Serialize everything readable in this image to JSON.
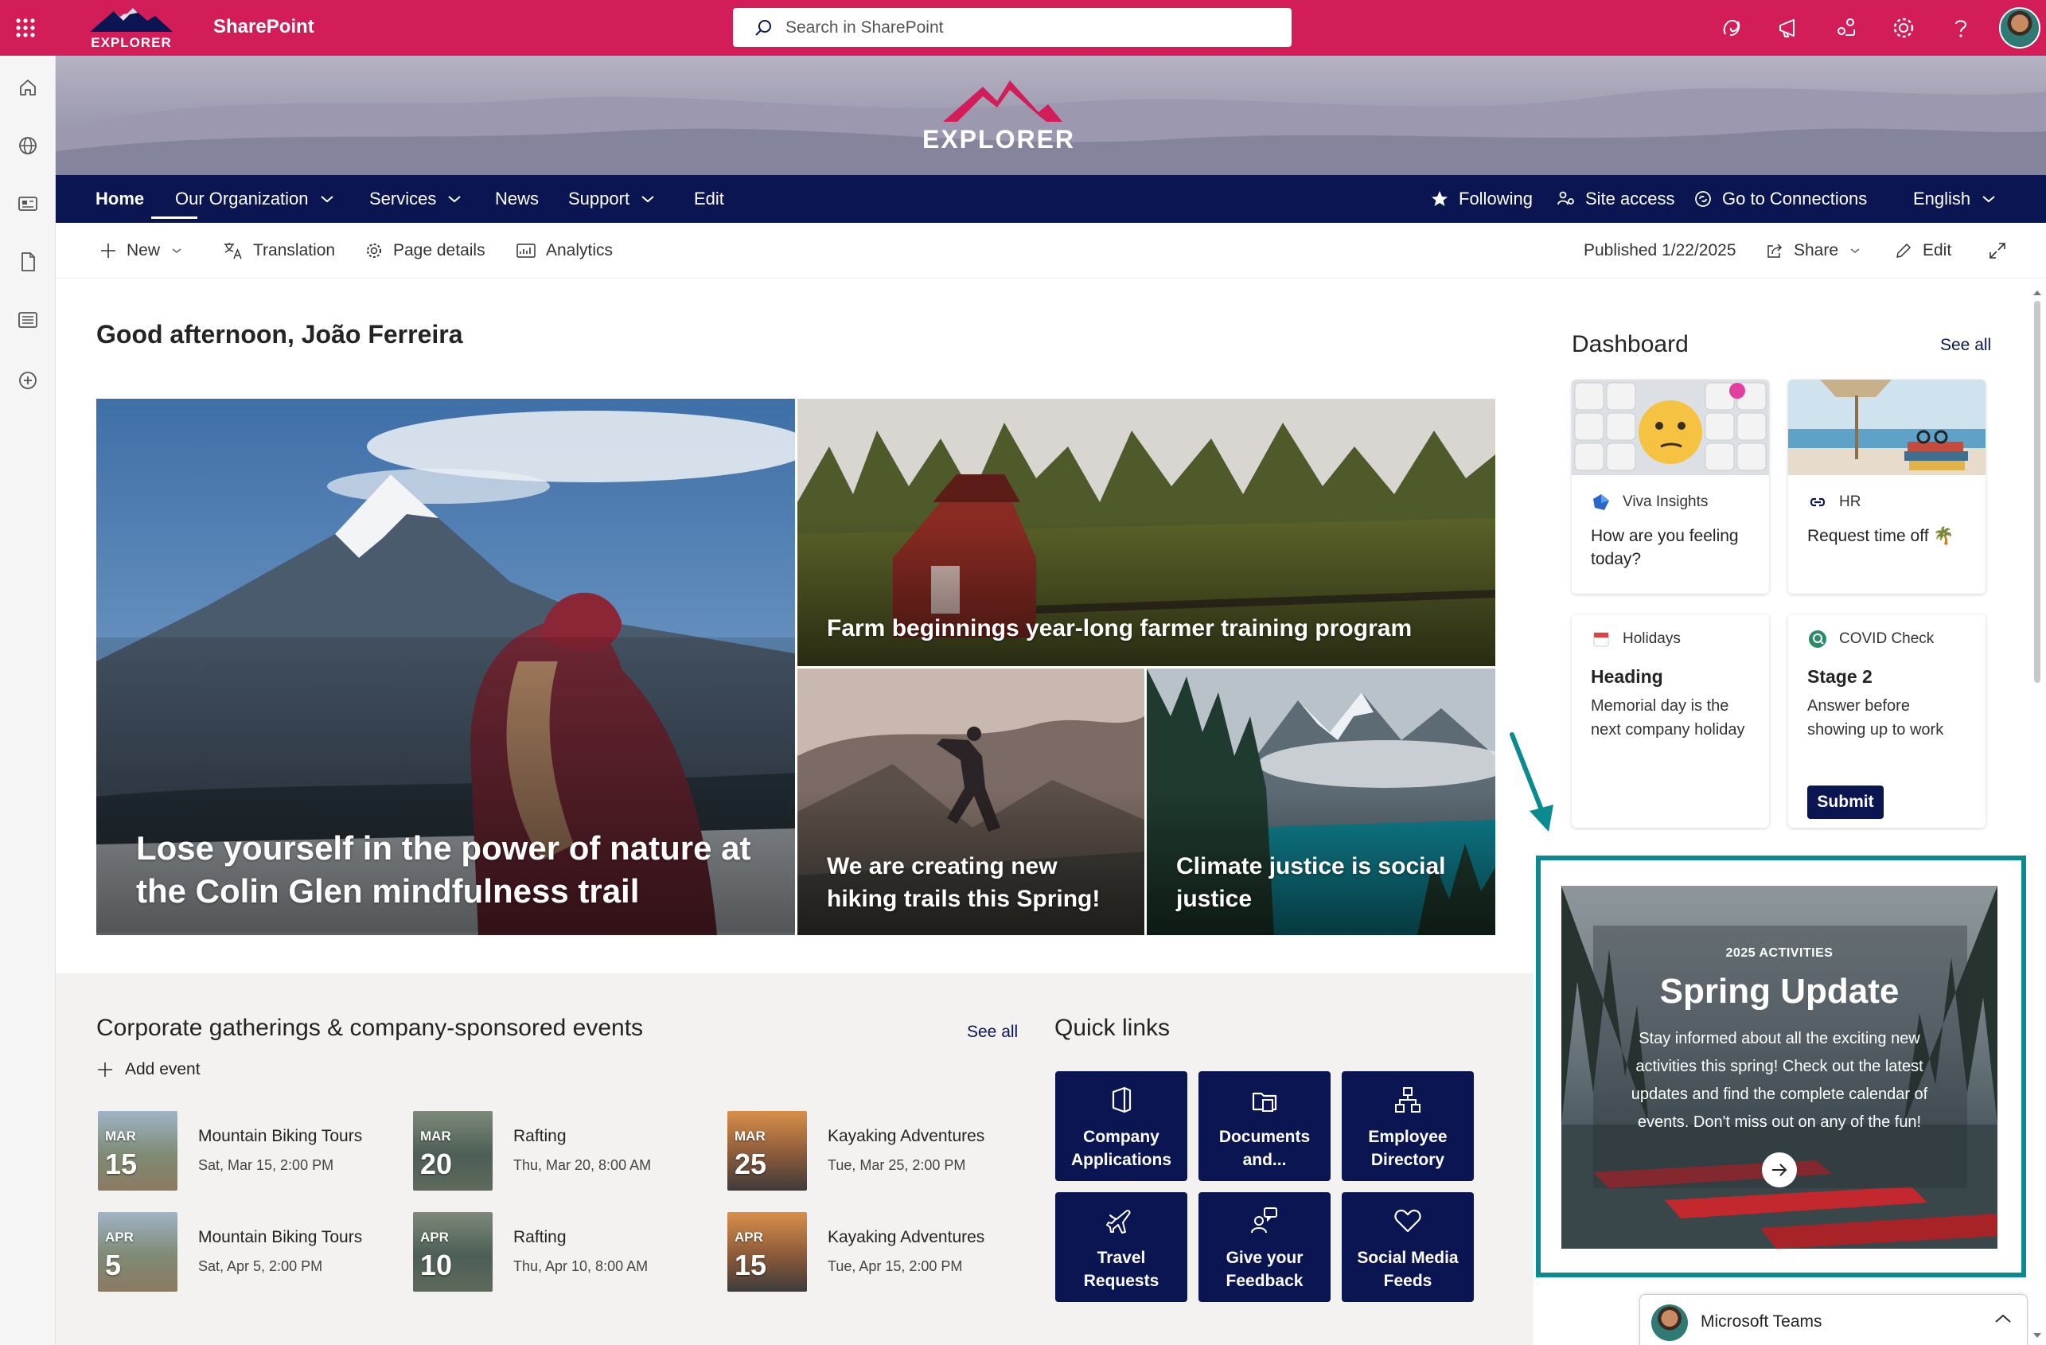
{
  "suite_bar": {
    "app_name": "SharePoint",
    "logo_text": "EXPLORER",
    "search_placeholder": "Search in SharePoint",
    "icons": [
      "app-launcher-icon",
      "copilot-icon",
      "megaphone-icon",
      "share-network-icon",
      "settings-icon",
      "help-icon",
      "avatar"
    ],
    "brand_color": "#d21d59"
  },
  "banner": {
    "logo_text": "EXPLORER"
  },
  "hub_nav": {
    "items": [
      {
        "label": "Home",
        "has_menu": false,
        "active": true
      },
      {
        "label": "Our Organization",
        "has_menu": true
      },
      {
        "label": "Services",
        "has_menu": true
      },
      {
        "label": "News",
        "has_menu": false
      },
      {
        "label": "Support",
        "has_menu": true
      },
      {
        "label": "Edit",
        "has_menu": false
      }
    ],
    "right": {
      "following": "Following",
      "site_access": "Site access",
      "connections": "Go to Connections",
      "language": "English"
    },
    "color": "#0b1552"
  },
  "command_bar": {
    "new": "New",
    "translation": "Translation",
    "page_details": "Page details",
    "analytics": "Analytics",
    "published": "Published 1/22/2025",
    "share": "Share",
    "edit": "Edit"
  },
  "greeting": "Good afternoon, João Ferreira",
  "hero": [
    {
      "title": "Lose yourself in the power of nature at the Colin Glen mindfulness trail"
    },
    {
      "title": "Farm beginnings year-long farmer training program"
    },
    {
      "title": "We are creating new hiking trails this Spring!"
    },
    {
      "title": "Climate justice is social justice"
    }
  ],
  "events": {
    "title": "Corporate gatherings & company-sponsored events",
    "see_all": "See all",
    "add_event": "Add event",
    "items": [
      {
        "month": "MAR",
        "day": "15",
        "title": "Mountain Biking Tours",
        "date": "Sat, Mar 15, 2:00 PM"
      },
      {
        "month": "MAR",
        "day": "20",
        "title": "Rafting",
        "date": "Thu, Mar 20, 8:00 AM"
      },
      {
        "month": "MAR",
        "day": "25",
        "title": "Kayaking Adventures",
        "date": "Tue, Mar 25, 2:00 PM"
      },
      {
        "month": "APR",
        "day": "5",
        "title": "Mountain Biking Tours",
        "date": "Sat, Apr 5, 2:00 PM"
      },
      {
        "month": "APR",
        "day": "10",
        "title": "Rafting",
        "date": "Thu, Apr 10, 8:00 AM"
      },
      {
        "month": "APR",
        "day": "15",
        "title": "Kayaking Adventures",
        "date": "Tue, Apr 15, 2:00 PM"
      }
    ]
  },
  "quick_links": {
    "title": "Quick links",
    "items": [
      {
        "label": "Company Applications",
        "icon": "office-icon"
      },
      {
        "label": "Documents and...",
        "icon": "folder-icon"
      },
      {
        "label": "Employee Directory",
        "icon": "org-chart-icon"
      },
      {
        "label": "Travel Requests",
        "icon": "airplane-icon"
      },
      {
        "label": "Give your Feedback",
        "icon": "people-feedback-icon"
      },
      {
        "label": "Social Media Feeds",
        "icon": "heart-icon"
      }
    ]
  },
  "dashboard": {
    "title": "Dashboard",
    "see_all": "See all",
    "cards": [
      {
        "app": "Viva Insights",
        "body": "How are you feeling today?"
      },
      {
        "app": "HR",
        "body": "Request time off 🌴"
      },
      {
        "app": "Holidays",
        "heading": "Heading",
        "text": "Memorial day is the next company holiday"
      },
      {
        "app": "COVID Check",
        "heading": "Stage 2",
        "text": "Answer before showing up to work",
        "button": "Submit"
      }
    ]
  },
  "spring_update": {
    "kicker": "2025 ACTIVITIES",
    "title": "Spring Update",
    "text": "Stay informed about all the exciting new activities this spring! Check out the latest updates and find the complete calendar of events. Don't miss out on any of the fun!",
    "highlight_color": "#0b8a8f"
  },
  "teams_chat": {
    "label": "Microsoft Teams"
  }
}
